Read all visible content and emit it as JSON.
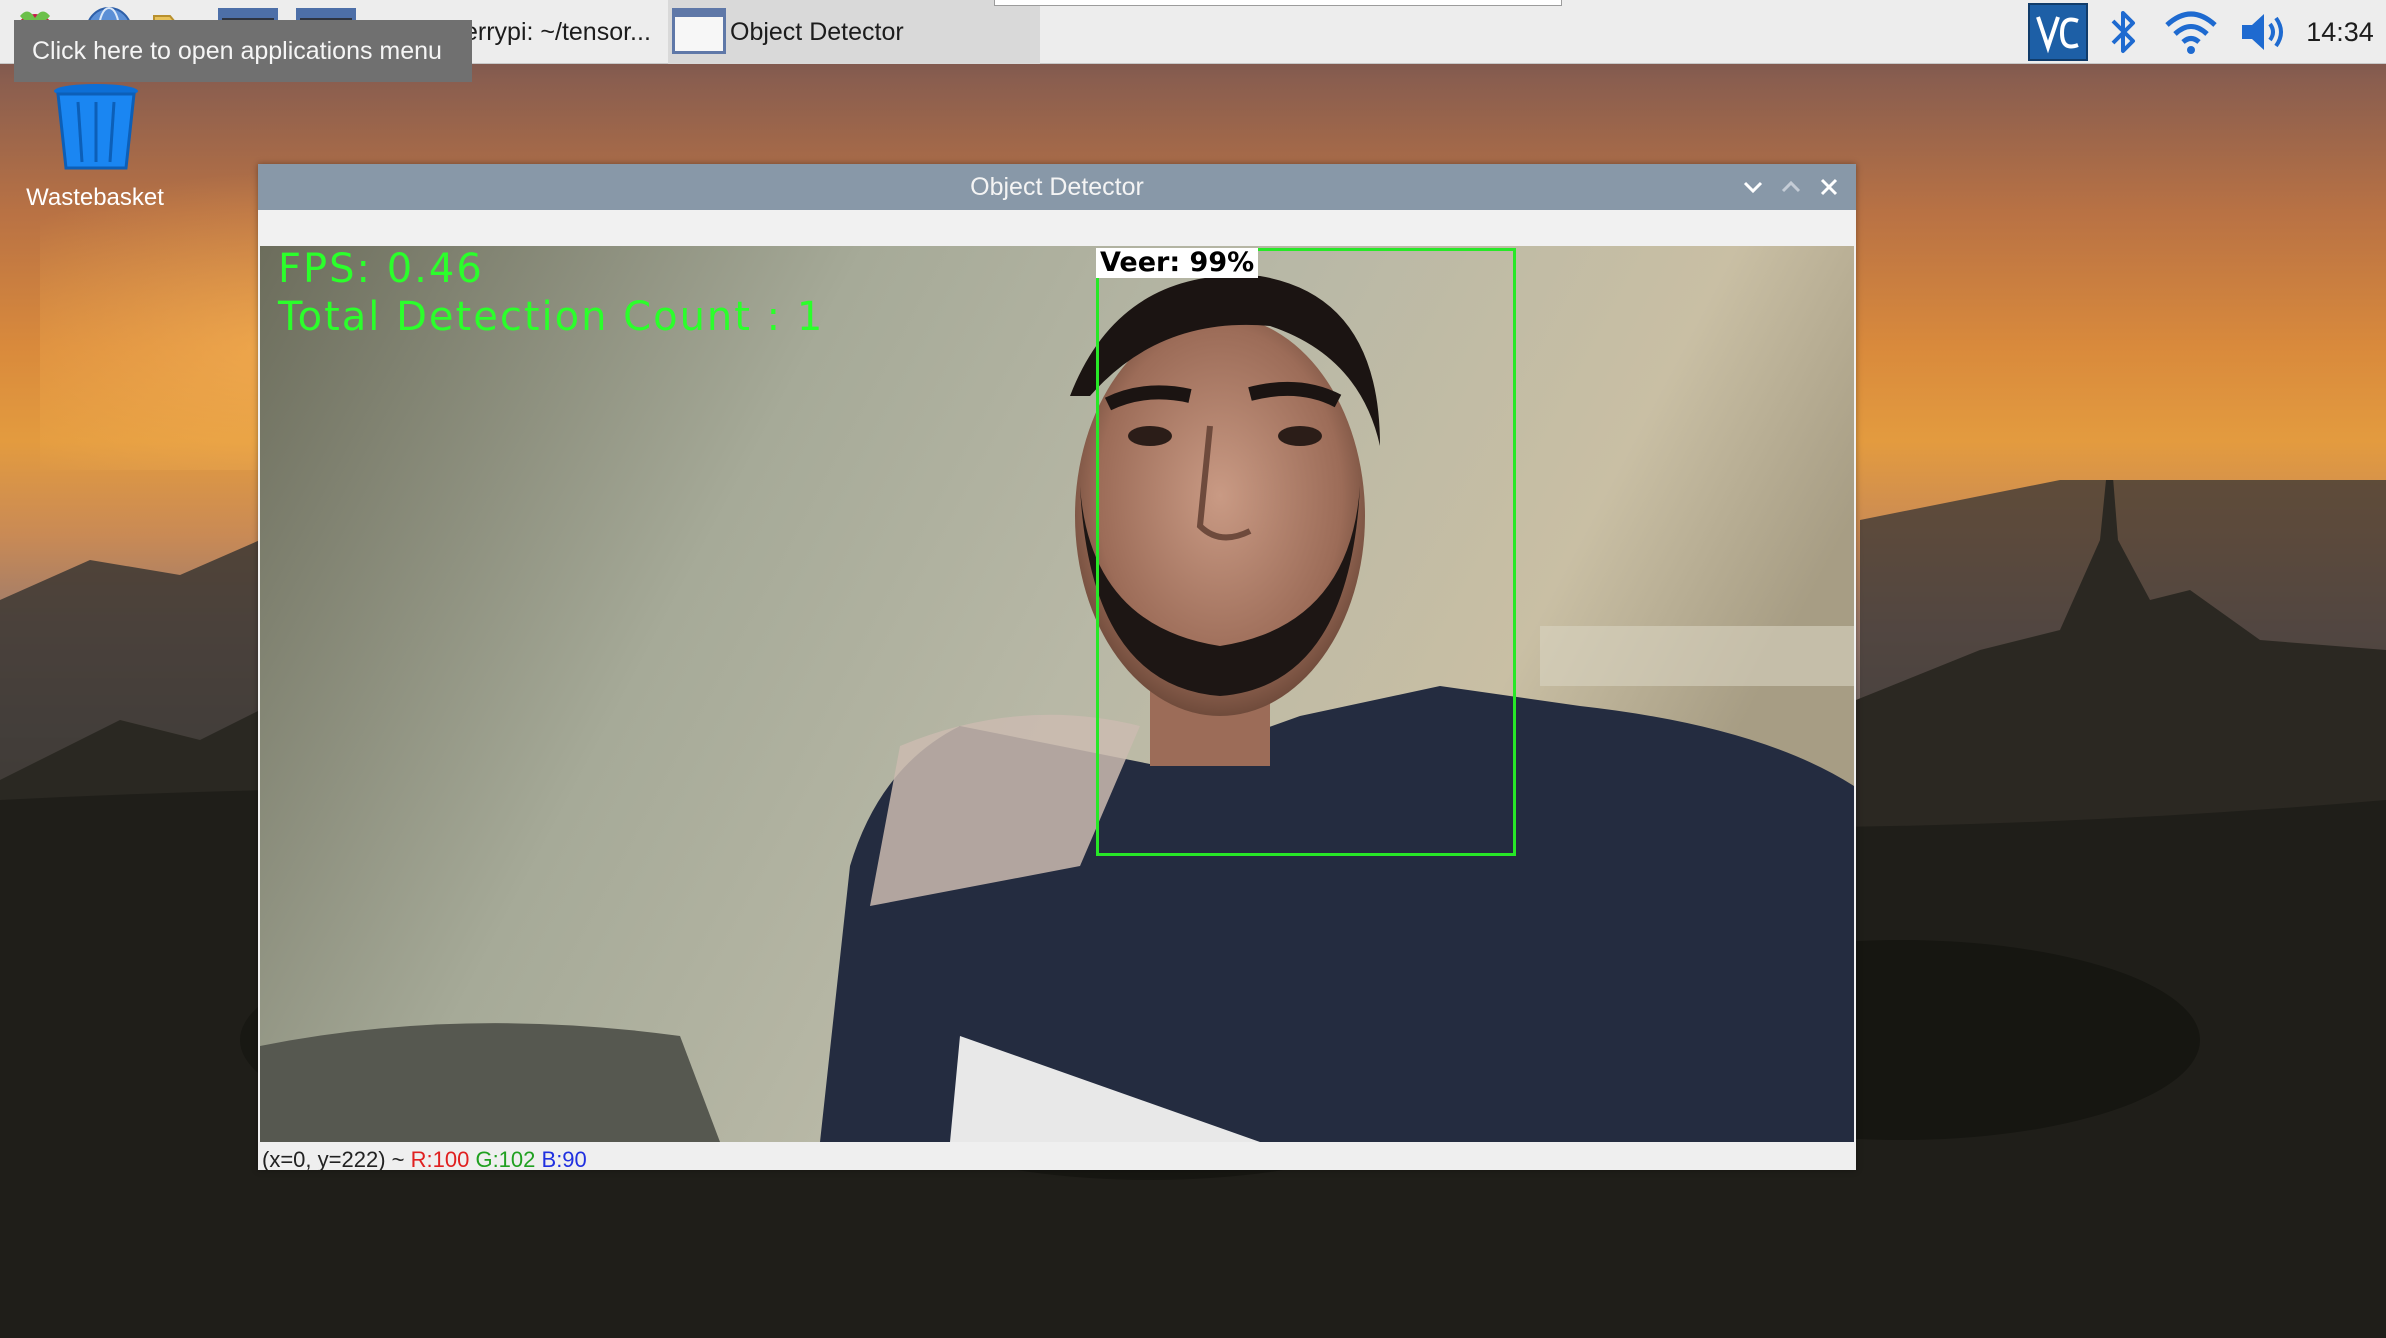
{
  "taskbar": {
    "tooltip": "Click here to open applications menu",
    "tasks": [
      {
        "label": "errypi: ~/tensor..."
      },
      {
        "label": "Object Detector"
      }
    ],
    "tray": {
      "vnc_icon": "vnc-icon",
      "bluetooth_icon": "bluetooth-icon",
      "wifi_icon": "wifi-icon",
      "volume_icon": "volume-icon"
    },
    "clock": "14:34"
  },
  "desktop": {
    "icons": [
      {
        "label": "Wastebasket",
        "icon": "trash-icon"
      }
    ]
  },
  "window": {
    "title": "Object Detector",
    "controls": {
      "minimize": "chevron-down-icon",
      "maximize": "chevron-up-icon",
      "close": "close-icon"
    },
    "overlay": {
      "fps": "FPS: 0.46",
      "detection_count": "Total Detection Count : 1",
      "detection_label": "Veer: 99%"
    },
    "status": {
      "coords": "(x=0, y=222) ~",
      "r": "R:100",
      "g": "G:102",
      "b": "B:90"
    }
  },
  "colors": {
    "overlay_green": "#2bff2b",
    "bbox_green": "#27e827",
    "titlebar": "#8898a8",
    "taskbar": "#ededed"
  }
}
